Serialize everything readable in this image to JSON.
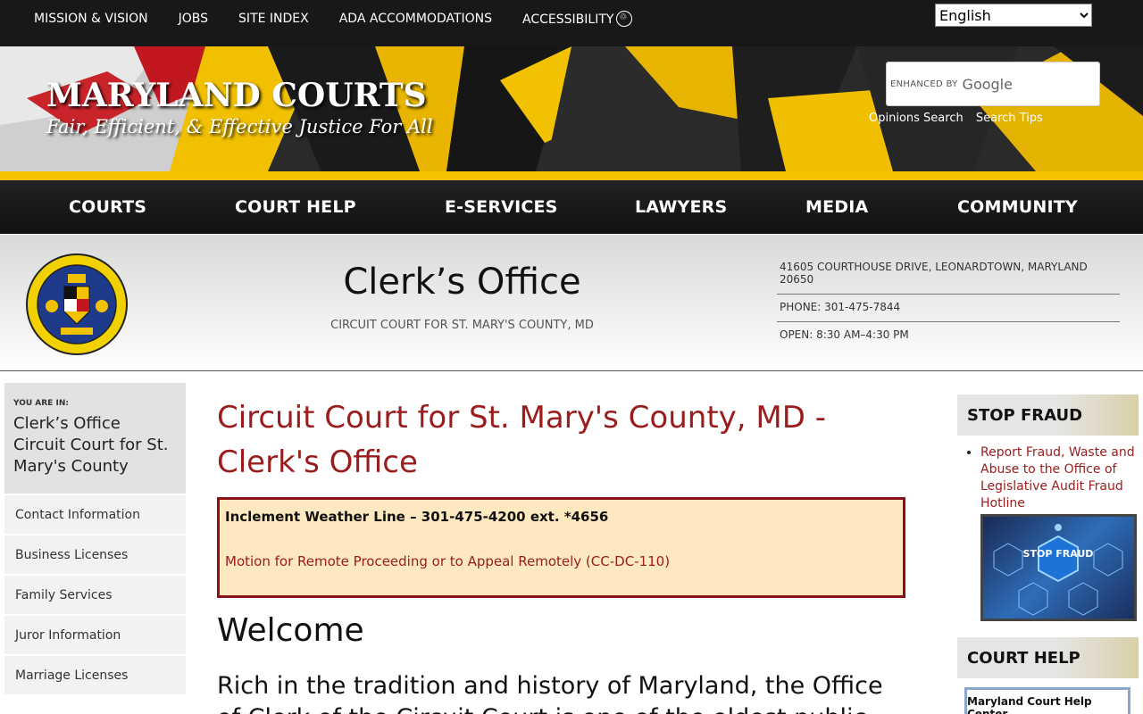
{
  "topbar": {
    "links": [
      "MISSION & VISION",
      "JOBS",
      "SITE INDEX",
      "ADA ACCOMMODATIONS",
      "ACCESSIBILITY"
    ],
    "language": "English"
  },
  "banner": {
    "title": "MARYLAND COURTS",
    "tagline": "Fair, Efficient, & Effective Justice For All",
    "search_enhanced": "ENHANCED BY",
    "search_brand": "Google",
    "search_links": [
      "Opinions Search",
      "Search Tips"
    ]
  },
  "nav": [
    "COURTS",
    "COURT HELP",
    "E-SERVICES",
    "LAWYERS",
    "MEDIA",
    "COMMUNITY"
  ],
  "office": {
    "title": "Clerk’s Office",
    "subtitle": "CIRCUIT COURT FOR ST. MARY'S COUNTY, MD",
    "address": "41605 COURTHOUSE DRIVE, LEONARDTOWN, MARYLAND 20650",
    "phone": "PHONE: 301-475-7844",
    "hours": "OPEN: 8:30 AM–4:30 PM",
    "seal_text_top": "ST. MARY'S COUNTY MARYLAND",
    "seal_year": "1637"
  },
  "sidebar": {
    "label": "YOU ARE IN:",
    "crumb_1": "Clerk’s Office",
    "crumb_2": "Circuit Court for St. Mary's County",
    "items": [
      "Contact Information",
      "Business Licenses",
      "Family Services",
      "Juror Information",
      "Marriage Licenses"
    ]
  },
  "main": {
    "heading": "Circuit Court for St. Mary's County, MD - Clerk's Office",
    "alert_weather": "Inclement Weather Line – 301-475-4200 ext. *4656",
    "alert_link": "Motion for Remote Proceeding or to Appeal Remotely (CC-DC-110)",
    "welcome": "Welcome",
    "intro": "Rich in the tradition and history of Maryland, the Office of Clerk of the Circuit Court is one of the oldest public"
  },
  "right": {
    "fraud_title": "STOP FRAUD",
    "fraud_link": "Report Fraud, Waste and Abuse to the Office of Legislative Audit Fraud Hotline",
    "fraud_img_text": "STOP FRAUD",
    "help_title": "COURT HELP",
    "help_button": "Maryland Court Help Center"
  }
}
